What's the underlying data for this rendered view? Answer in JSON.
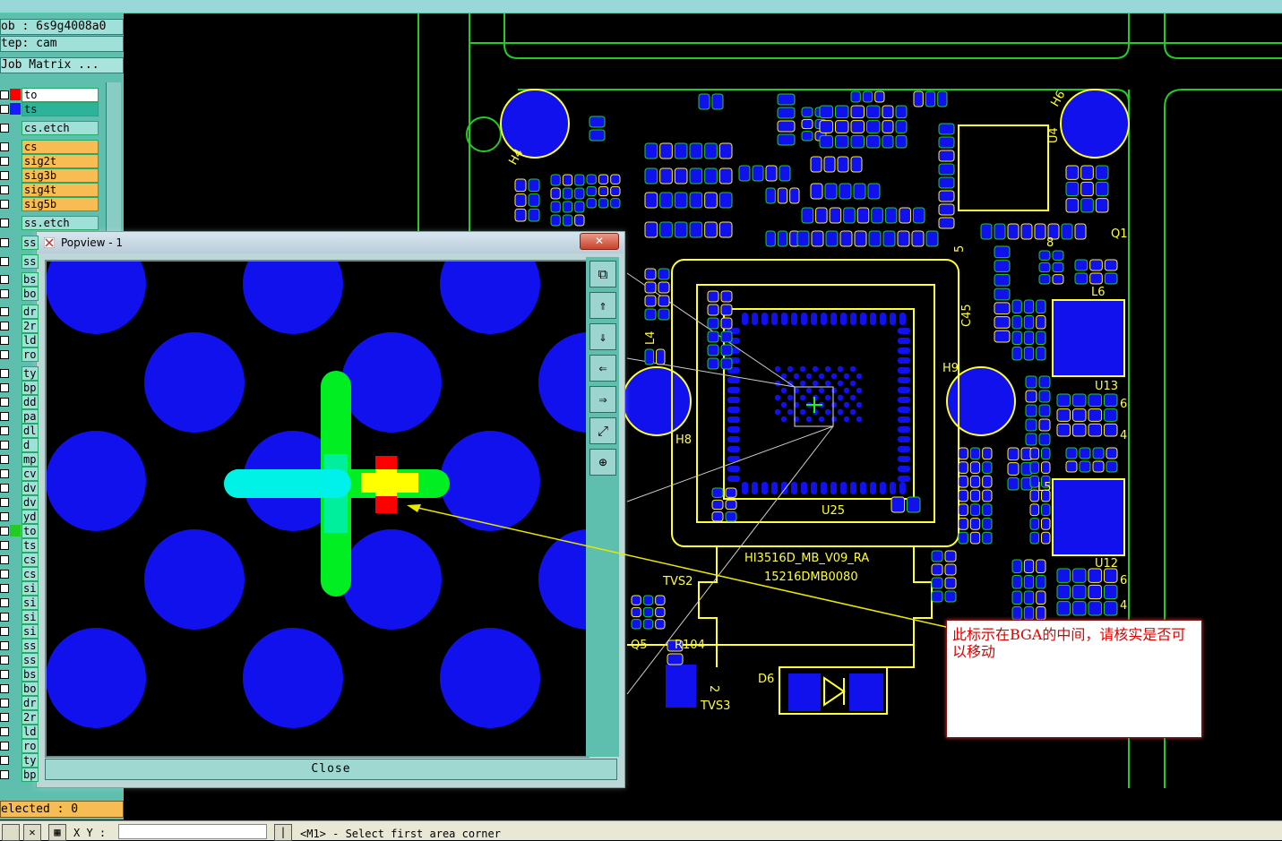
{
  "window": {
    "job_label": "ob : 6s9g4008a0",
    "step_label": "tep: cam",
    "job_matrix_label": "Job Matrix ..."
  },
  "layers": {
    "top": [
      {
        "name": "to",
        "color": "#ff0000",
        "bg": "#ffffff"
      },
      {
        "name": "ts",
        "color": "#1a1aff",
        "bg": "#2db39a"
      }
    ],
    "etch1": "cs.etch",
    "signals": [
      "cs",
      "sig2t",
      "sig3b",
      "sig4t",
      "sig5b"
    ],
    "etch2": "ss.etch",
    "stubs": [
      "ss",
      "ss",
      "bs",
      "bo",
      "dr",
      "2r",
      "ld",
      "ro",
      "ty",
      "bp",
      "dd",
      "pa",
      "dl",
      "d",
      "mp",
      "cv",
      "dv",
      "dv",
      "yd",
      "to",
      "ts",
      "cs",
      "cs",
      "si",
      "si",
      "si",
      "si",
      "ss",
      "ss",
      "bs",
      "bo",
      "dr",
      "2r",
      "ld",
      "ro",
      "ty",
      "bp.d"
    ]
  },
  "selected_label": "elected : 0",
  "status": {
    "xy_label": "X Y :",
    "prompt": "<M1> - Select first area corner"
  },
  "popview": {
    "title": "Popview - 1",
    "close_x": "✕",
    "close_label": "Close",
    "tools": [
      "zoom-window-icon",
      "pan-up-icon",
      "pan-down-icon",
      "pan-left-icon",
      "pan-right-icon",
      "zoom-fit-icon",
      "center-icon"
    ]
  },
  "board": {
    "refs": [
      "H4",
      "H6",
      "U4",
      "Q1",
      "L6",
      "C45",
      "L4",
      "H9",
      "U13",
      "H8",
      "U25",
      "L5",
      "U12",
      "HI3516D_MB_V09_RA",
      "15216DMB0080",
      "TVS2",
      "Q5",
      "R104",
      "D6",
      "TVS3",
      "6",
      "4",
      "6",
      "4",
      "2",
      "5",
      "8"
    ]
  },
  "note": {
    "text": "此标示在BGA的中间，请核实是否可以移动"
  },
  "colors": {
    "outline": "#ffff33",
    "board": "#22cc22",
    "pad": "#1111ee",
    "note_text": "#e00000"
  }
}
